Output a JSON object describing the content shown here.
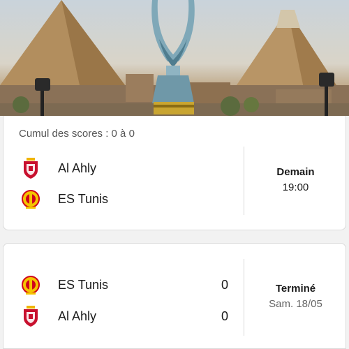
{
  "header_image": {
    "description_icon": "trophy-pyramids-banner"
  },
  "aggregate": {
    "label": "Cumul des scores : 0 à 0"
  },
  "matches": [
    {
      "teams": [
        {
          "name": "Al Ahly",
          "crest_icon": "al-ahly-crest-icon"
        },
        {
          "name": "ES Tunis",
          "crest_icon": "es-tunis-crest-icon"
        }
      ],
      "status": "Demain",
      "time": "19:00"
    },
    {
      "teams": [
        {
          "name": "ES Tunis",
          "crest_icon": "es-tunis-crest-icon",
          "score": "0"
        },
        {
          "name": "Al Ahly",
          "crest_icon": "al-ahly-crest-icon",
          "score": "0"
        }
      ],
      "status": "Terminé",
      "date": "Sam. 18/05"
    }
  ],
  "colors": {
    "ahly_red": "#c8102e",
    "esperance_red": "#d0021b",
    "esperance_yellow": "#f5c400",
    "card_bg": "#ffffff",
    "page_bg": "#f2f2f2"
  }
}
